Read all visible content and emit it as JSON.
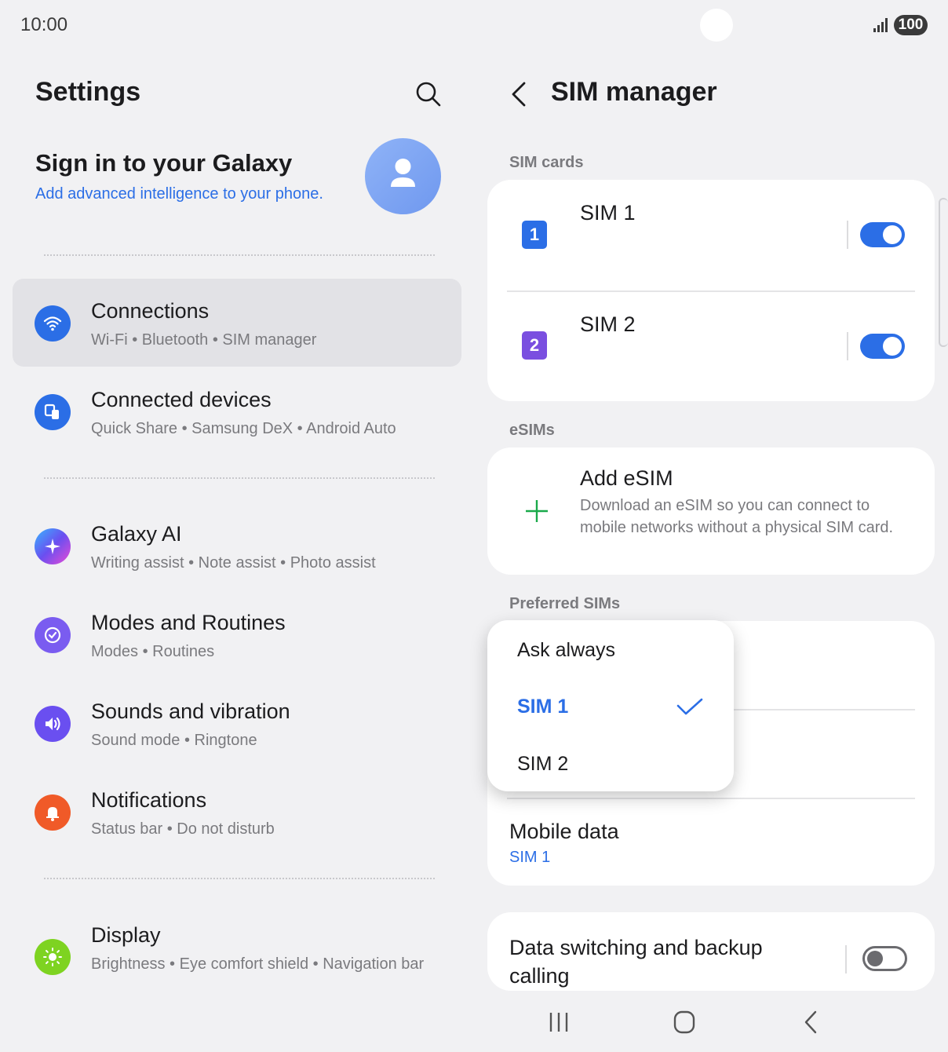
{
  "status": {
    "time": "10:00",
    "battery": "100"
  },
  "left": {
    "title": "Settings",
    "account": {
      "title": "Sign in to your Galaxy",
      "subtitle": "Add advanced intelligence to your phone."
    },
    "items": [
      {
        "title": "Connections",
        "subtitle": "Wi-Fi  •  Bluetooth  •  SIM manager",
        "icon_color": "#2b6ee6"
      },
      {
        "title": "Connected devices",
        "subtitle": "Quick Share  •  Samsung DeX  •  Android Auto",
        "icon_color": "#2b6ee6"
      },
      {
        "title": "Galaxy AI",
        "subtitle": "Writing assist  •  Note assist  •  Photo assist",
        "icon_color": "#6a4ff0"
      },
      {
        "title": "Modes and Routines",
        "subtitle": "Modes  •  Routines",
        "icon_color": "#7a5cf0"
      },
      {
        "title": "Sounds and vibration",
        "subtitle": "Sound mode  •  Ringtone",
        "icon_color": "#6a4ff0"
      },
      {
        "title": "Notifications",
        "subtitle": "Status bar  •  Do not disturb",
        "icon_color": "#f05a28"
      },
      {
        "title": "Display",
        "subtitle": "Brightness  •  Eye comfort shield  •  Navigation bar",
        "icon_color": "#7ed321"
      }
    ]
  },
  "right": {
    "title": "SIM manager",
    "sim_cards_label": "SIM cards",
    "sims": [
      {
        "name": "SIM 1",
        "badge": "1",
        "color": "#2b6ee6",
        "enabled": true
      },
      {
        "name": "SIM 2",
        "badge": "2",
        "color": "#7a4fe0",
        "enabled": true
      }
    ],
    "esims_label": "eSIMs",
    "add_esim": {
      "title": "Add eSIM",
      "description": "Download an eSIM so you can connect to mobile networks without a physical SIM card."
    },
    "preferred_label": "Preferred SIMs",
    "mobile_data": {
      "title": "Mobile data",
      "value": "SIM 1"
    },
    "data_switching": {
      "title": "Data switching and backup calling",
      "enabled": false
    },
    "popup": {
      "options": [
        "Ask always",
        "SIM 1",
        "SIM 2"
      ],
      "selected": "SIM 1"
    }
  }
}
